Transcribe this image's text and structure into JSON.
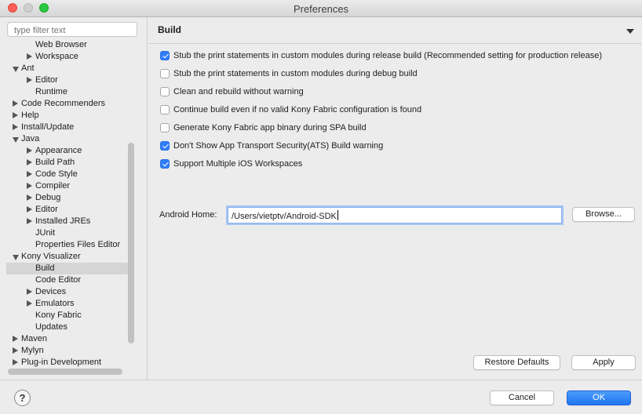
{
  "window": {
    "title": "Preferences"
  },
  "sidebar": {
    "filter_placeholder": "type filter text",
    "items": [
      {
        "label": "Web Browser",
        "indent": 1,
        "twisty": "none"
      },
      {
        "label": "Workspace",
        "indent": 1,
        "twisty": "right"
      },
      {
        "label": "Ant",
        "indent": 0,
        "twisty": "down"
      },
      {
        "label": "Editor",
        "indent": 1,
        "twisty": "right"
      },
      {
        "label": "Runtime",
        "indent": 1,
        "twisty": "none"
      },
      {
        "label": "Code Recommenders",
        "indent": 0,
        "twisty": "right"
      },
      {
        "label": "Help",
        "indent": 0,
        "twisty": "right"
      },
      {
        "label": "Install/Update",
        "indent": 0,
        "twisty": "right"
      },
      {
        "label": "Java",
        "indent": 0,
        "twisty": "down"
      },
      {
        "label": "Appearance",
        "indent": 1,
        "twisty": "right"
      },
      {
        "label": "Build Path",
        "indent": 1,
        "twisty": "right"
      },
      {
        "label": "Code Style",
        "indent": 1,
        "twisty": "right"
      },
      {
        "label": "Compiler",
        "indent": 1,
        "twisty": "right"
      },
      {
        "label": "Debug",
        "indent": 1,
        "twisty": "right"
      },
      {
        "label": "Editor",
        "indent": 1,
        "twisty": "right"
      },
      {
        "label": "Installed JREs",
        "indent": 1,
        "twisty": "right"
      },
      {
        "label": "JUnit",
        "indent": 1,
        "twisty": "none"
      },
      {
        "label": "Properties Files Editor",
        "indent": 1,
        "twisty": "none"
      },
      {
        "label": "Kony Visualizer",
        "indent": 0,
        "twisty": "down"
      },
      {
        "label": "Build",
        "indent": 1,
        "twisty": "none",
        "selected": true
      },
      {
        "label": "Code Editor",
        "indent": 1,
        "twisty": "none"
      },
      {
        "label": "Devices",
        "indent": 1,
        "twisty": "right"
      },
      {
        "label": "Emulators",
        "indent": 1,
        "twisty": "right"
      },
      {
        "label": "Kony Fabric",
        "indent": 1,
        "twisty": "none"
      },
      {
        "label": "Updates",
        "indent": 1,
        "twisty": "none"
      },
      {
        "label": "Maven",
        "indent": 0,
        "twisty": "right"
      },
      {
        "label": "Mylyn",
        "indent": 0,
        "twisty": "right"
      },
      {
        "label": "Plug-in Development",
        "indent": 0,
        "twisty": "right"
      }
    ]
  },
  "page": {
    "title": "Build",
    "options": [
      {
        "label": "Stub the print statements in custom modules during release build (Recommended setting for production release)",
        "checked": true
      },
      {
        "label": "Stub the print statements in custom modules during debug build",
        "checked": false
      },
      {
        "label": "Clean and rebuild without warning",
        "checked": false
      },
      {
        "label": "Continue build even if no valid Kony Fabric configuration is found",
        "checked": false
      },
      {
        "label": "Generate Kony Fabric app binary during SPA build",
        "checked": false
      },
      {
        "label": "Don't Show App Transport Security(ATS) Build warning",
        "checked": true
      },
      {
        "label": "Support Multiple iOS Workspaces",
        "checked": true
      }
    ],
    "android_home_label": "Android Home:",
    "android_home_value": "/Users/vietptv/Android-SDK",
    "browse_label": "Browse...",
    "restore_defaults_label": "Restore Defaults",
    "apply_label": "Apply"
  },
  "footer": {
    "help_label": "?",
    "cancel_label": "Cancel",
    "ok_label": "OK"
  },
  "colors": {
    "accent": "#2f7dfa",
    "selection": "#d5d5d5"
  }
}
